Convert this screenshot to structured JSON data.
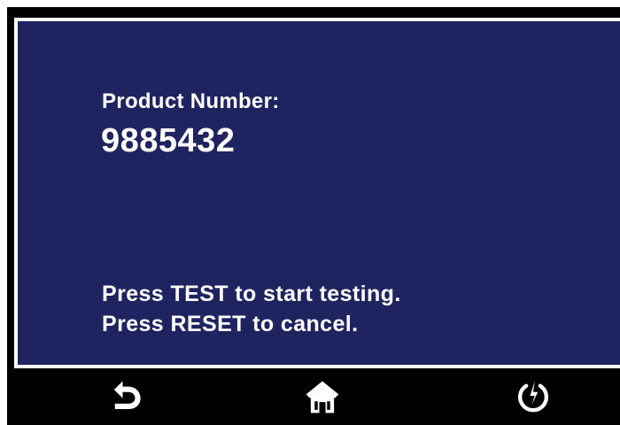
{
  "screen": {
    "product_label": "Product Number:",
    "product_number": "9885432",
    "instructions": [
      "Press TEST to start testing.",
      "Press RESET to cancel."
    ]
  },
  "nav": {
    "back_icon": "back-arrow-icon",
    "home_icon": "home-icon",
    "power_icon": "power-icon"
  },
  "colors": {
    "screen_bg": "#1f2460",
    "bezel": "#000000",
    "text": "#ffffff"
  }
}
